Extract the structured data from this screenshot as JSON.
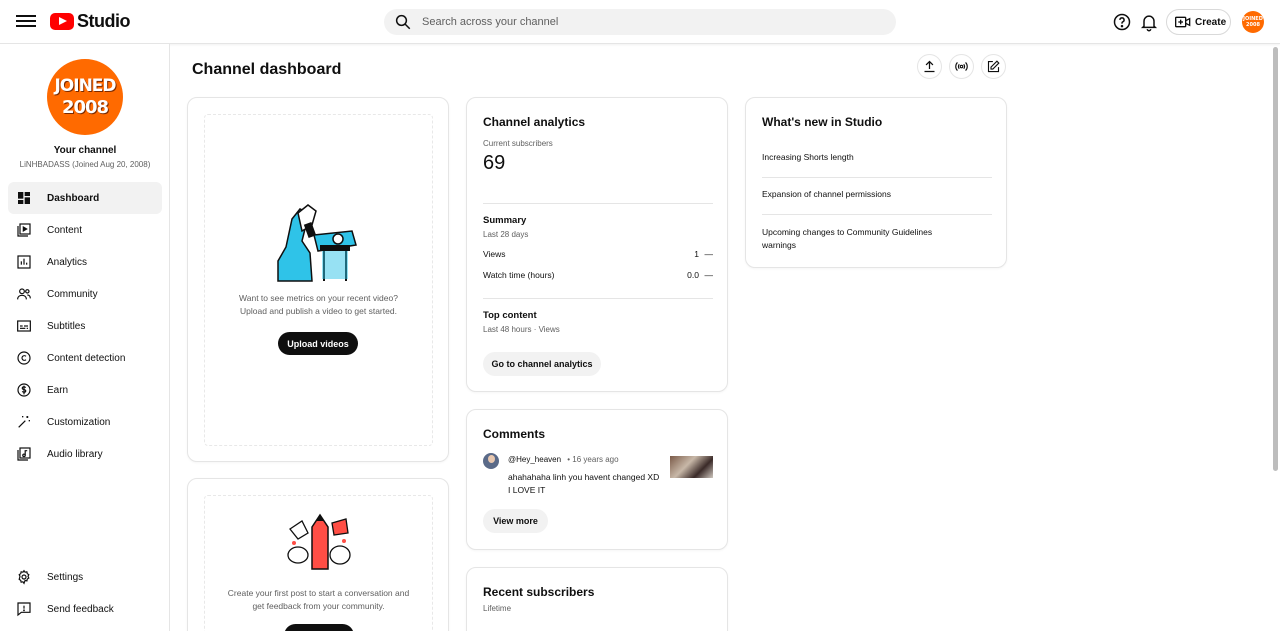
{
  "app": {
    "logo_text": "Studio"
  },
  "search": {
    "placeholder": "Search across your channel"
  },
  "header": {
    "create_label": "Create"
  },
  "channel": {
    "avatar_line1": "JOINED",
    "avatar_line2": "2008",
    "top_avatar_line1": "JOINED",
    "top_avatar_line2": "2008",
    "title": "Your channel",
    "subtitle": "LiNHBADASS (Joined Aug 20, 2008)"
  },
  "sidebar": {
    "items": [
      {
        "label": "Dashboard",
        "icon": "dashboard-icon",
        "active": true
      },
      {
        "label": "Content",
        "icon": "content-icon"
      },
      {
        "label": "Analytics",
        "icon": "analytics-icon"
      },
      {
        "label": "Community",
        "icon": "community-icon"
      },
      {
        "label": "Subtitles",
        "icon": "subtitles-icon"
      },
      {
        "label": "Content detection",
        "icon": "copyright-icon"
      },
      {
        "label": "Earn",
        "icon": "dollar-icon"
      },
      {
        "label": "Customization",
        "icon": "magic-wand-icon"
      },
      {
        "label": "Audio library",
        "icon": "audio-library-icon"
      }
    ],
    "bottom": [
      {
        "label": "Settings",
        "icon": "gear-icon"
      },
      {
        "label": "Send feedback",
        "icon": "feedback-icon"
      }
    ]
  },
  "page": {
    "title": "Channel dashboard"
  },
  "upload_card": {
    "text_line1": "Want to see metrics on your recent video?",
    "text_line2": "Upload and publish a video to get started.",
    "button": "Upload videos"
  },
  "post_card": {
    "text_line1": "Create your first post to start a conversation and",
    "text_line2": "get feedback from your community."
  },
  "analytics": {
    "title": "Channel analytics",
    "subs_label": "Current subscribers",
    "subs_value": "69",
    "summary_title": "Summary",
    "summary_period": "Last 28 days",
    "rows": [
      {
        "label": "Views",
        "value": "1",
        "trend": "—"
      },
      {
        "label": "Watch time (hours)",
        "value": "0.0",
        "trend": "—"
      }
    ],
    "top_content_title": "Top content",
    "top_content_period": "Last 48 hours · Views",
    "button": "Go to channel analytics"
  },
  "comments": {
    "title": "Comments",
    "author": "@Hey_heaven",
    "time": "• 16 years ago",
    "text_line1": "ahahahaha linh you havent changed XD",
    "text_line2": "I LOVE IT",
    "button": "View more"
  },
  "recent_subs": {
    "title": "Recent subscribers",
    "period": "Lifetime"
  },
  "whats_new": {
    "title": "What's new in Studio",
    "items": [
      {
        "line1": "Increasing Shorts length",
        "line2": ""
      },
      {
        "line1": "Expansion of channel permissions",
        "line2": ""
      },
      {
        "line1": "Upcoming changes to Community Guidelines",
        "line2": "warnings"
      }
    ]
  },
  "colors": {
    "brand_red": "#ff0000",
    "avatar_orange": "#ff6a00",
    "text": "#0f0f0f",
    "secondary": "#606060"
  }
}
